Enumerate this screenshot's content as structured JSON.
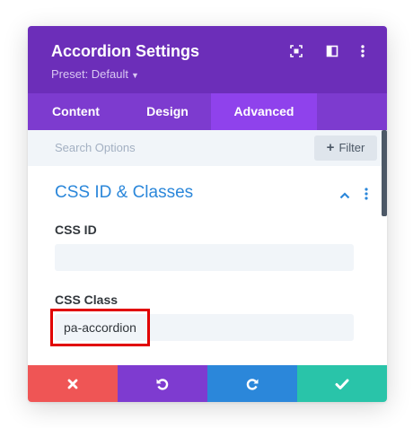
{
  "header": {
    "title": "Accordion Settings",
    "preset": "Preset: Default",
    "icons": [
      "focus-mode-icon",
      "split-view-icon",
      "more-vertical-icon"
    ]
  },
  "tabs": [
    {
      "label": "Content",
      "active": false
    },
    {
      "label": "Design",
      "active": false
    },
    {
      "label": "Advanced",
      "active": true
    }
  ],
  "search": {
    "placeholder": "Search Options",
    "filter_label": "Filter"
  },
  "section": {
    "title": "CSS ID & Classes",
    "fields": [
      {
        "label": "CSS ID",
        "value": ""
      },
      {
        "label": "CSS Class",
        "value": "pa-accordion"
      }
    ]
  },
  "actions": [
    {
      "name": "discard",
      "icon": "close-icon",
      "color": "#ef5555"
    },
    {
      "name": "undo",
      "icon": "undo-icon",
      "color": "#7e3bd0"
    },
    {
      "name": "redo",
      "icon": "redo-icon",
      "color": "#2b87da"
    },
    {
      "name": "save",
      "icon": "check-icon",
      "color": "#29c4a9"
    }
  ],
  "colors": {
    "header": "#6c2eb9",
    "tabs": "#7d3bcf",
    "active_tab": "#8f42ec",
    "section_title": "#2b87da",
    "highlight": "#e10000"
  }
}
